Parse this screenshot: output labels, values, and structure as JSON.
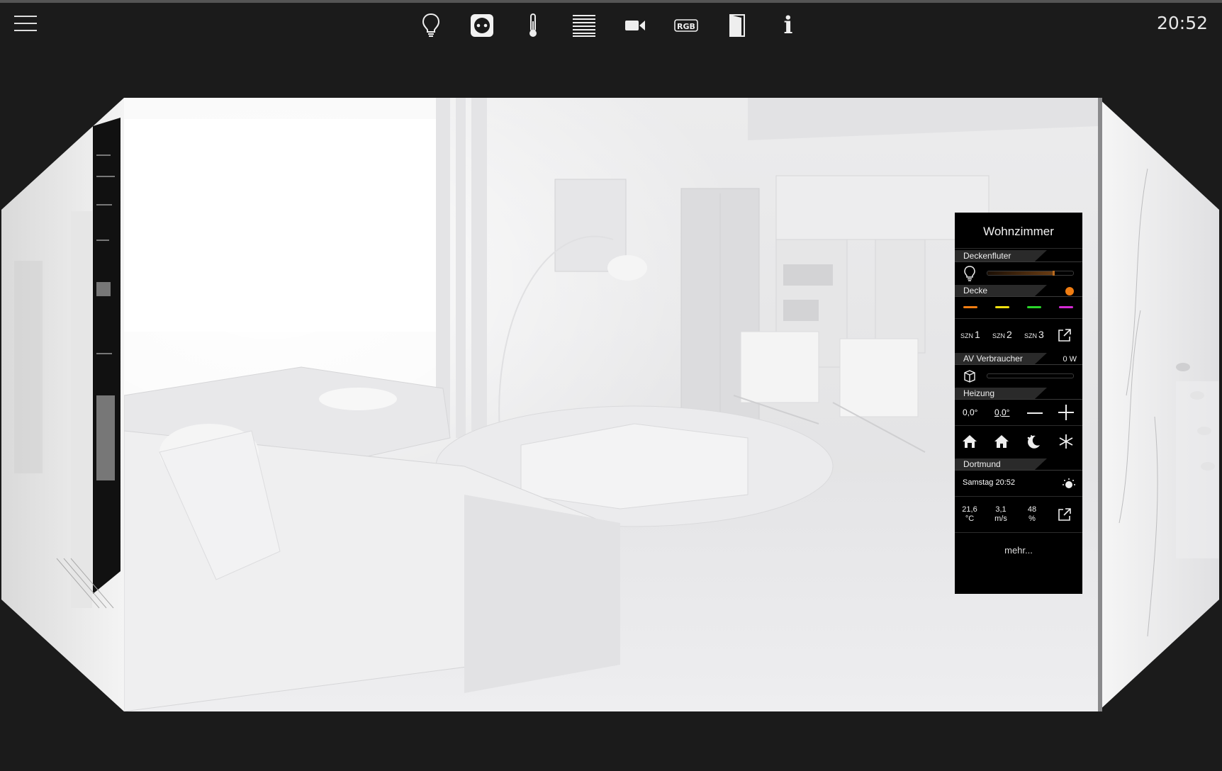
{
  "topbar": {
    "clock": "20:52",
    "categories": [
      {
        "icon": "lightbulb-icon"
      },
      {
        "icon": "power-socket-icon"
      },
      {
        "icon": "thermometer-icon"
      },
      {
        "icon": "blinds-icon"
      },
      {
        "icon": "video-camera-icon"
      },
      {
        "icon": "rgb-icon",
        "label": "RGB"
      },
      {
        "icon": "door-icon"
      },
      {
        "icon": "info-icon",
        "label": "i"
      }
    ]
  },
  "widget": {
    "title": "Wohnzimmer",
    "deckenfluter": {
      "label": "Deckenfluter",
      "level": 0.78
    },
    "decke": {
      "label": "Decke",
      "status_color": "#f07d12",
      "color_presets": [
        "#f07d12",
        "#f0e010",
        "#2ad62a",
        "#d42ad4"
      ]
    },
    "scenes": [
      {
        "prefix": "SZN",
        "num": "1"
      },
      {
        "prefix": "SZN",
        "num": "2"
      },
      {
        "prefix": "SZN",
        "num": "3"
      }
    ],
    "av": {
      "label": "AV Verbraucher",
      "power": "0 W",
      "level": 0.0
    },
    "heizung": {
      "label": "Heizung",
      "actual": "0,0°",
      "setpoint": "0,0°",
      "modes": [
        "home-comfort-icon",
        "home-standby-icon",
        "night-mode-icon",
        "frost-protection-icon"
      ]
    },
    "weather": {
      "location": "Dortmund",
      "datetime": "Samstag 20:52",
      "temp": "21,6",
      "temp_unit": "°C",
      "wind": "3,1",
      "wind_unit": "m/s",
      "humidity": "48",
      "humidity_unit": "%"
    },
    "more_label": "mehr..."
  },
  "colors": {
    "accent": "#f07d12",
    "background": "#1b1b1b",
    "panel": "#000000"
  }
}
